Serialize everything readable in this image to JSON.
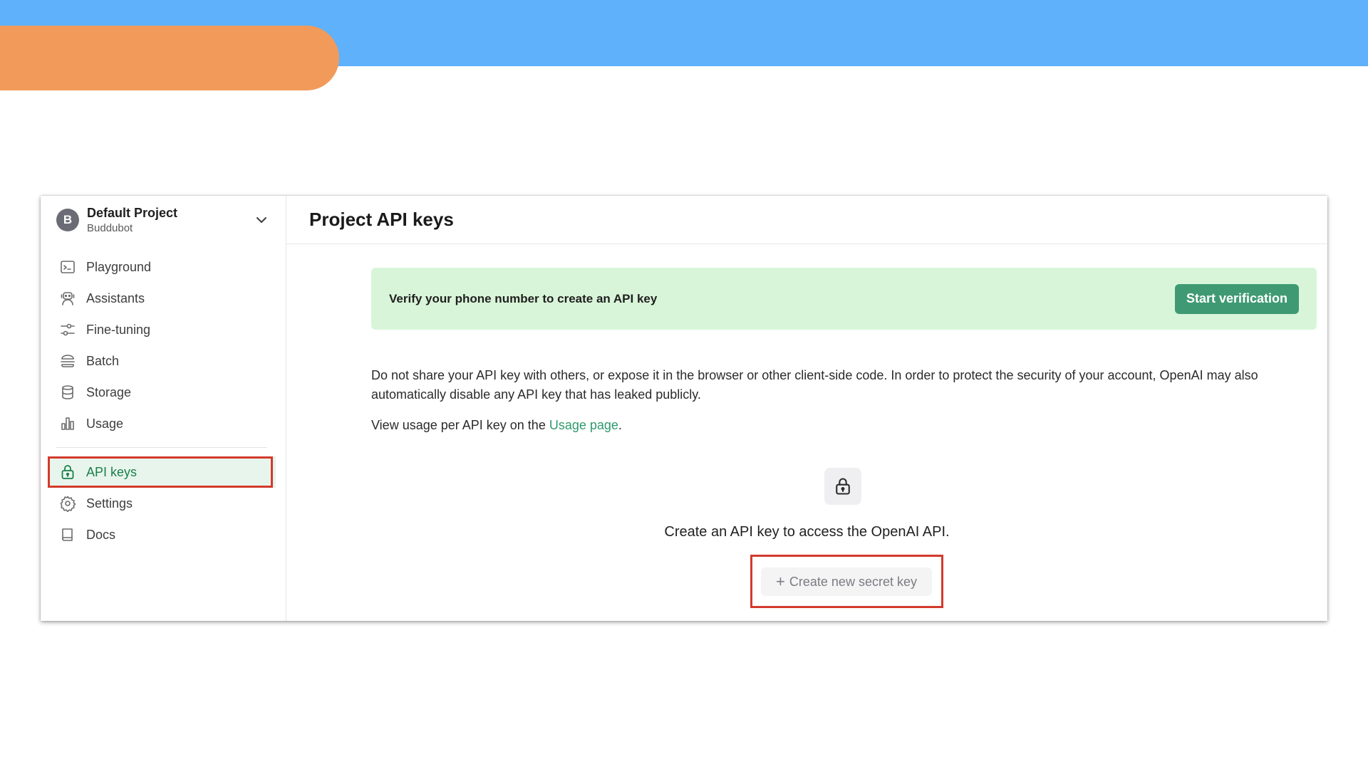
{
  "project": {
    "avatar_letter": "B",
    "name": "Default Project",
    "org": "Buddubot"
  },
  "sidebar": {
    "items": [
      {
        "label": "Playground",
        "icon": "terminal-icon"
      },
      {
        "label": "Assistants",
        "icon": "robot-icon"
      },
      {
        "label": "Fine-tuning",
        "icon": "sliders-icon"
      },
      {
        "label": "Batch",
        "icon": "layers-icon"
      },
      {
        "label": "Storage",
        "icon": "database-icon"
      },
      {
        "label": "Usage",
        "icon": "bar-chart-icon"
      }
    ],
    "secondary_items": [
      {
        "label": "API keys",
        "icon": "lock-icon",
        "active": true
      },
      {
        "label": "Settings",
        "icon": "gear-icon"
      },
      {
        "label": "Docs",
        "icon": "book-icon"
      }
    ]
  },
  "main": {
    "title": "Project API keys",
    "banner": {
      "text": "Verify your phone number to create an API key",
      "button_label": "Start verification"
    },
    "warning": "Do not share your API key with others, or expose it in the browser or other client-side code. In order to protect the security of your account, OpenAI may also automatically disable any API key that has leaked publicly.",
    "usage_prefix": "View usage per API key on the ",
    "usage_link": "Usage page",
    "usage_suffix": ".",
    "empty_state_title": "Create an API key to access the OpenAI API.",
    "create_button_label": "Create new secret key"
  },
  "colors": {
    "top_band": "#5eb1fa",
    "orange_pill": "#f29a5a",
    "accent_green": "#3f9a73",
    "banner_bg": "#d9f5d9",
    "highlight_red": "#d33a2c"
  }
}
